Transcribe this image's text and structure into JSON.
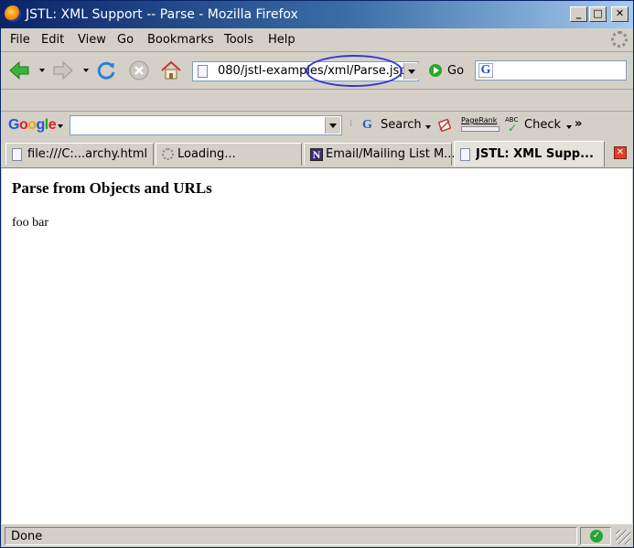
{
  "window": {
    "title": "JSTL: XML Support -- Parse - Mozilla Firefox",
    "minimize_label": "_",
    "maximize_label": "□",
    "close_label": "✕"
  },
  "menu": [
    "File",
    "Edit",
    "View",
    "Go",
    "Bookmarks",
    "Tools",
    "Help"
  ],
  "navigation": {
    "url": "080/jstl-examples/xml/Parse.jsp",
    "go_label": "Go",
    "search_engine_icon": "G",
    "search_value": ""
  },
  "google_toolbar": {
    "logo": [
      "G",
      "o",
      "o",
      "g",
      "l",
      "e"
    ],
    "search_value": "",
    "search_icon": "G",
    "search_label": "Search",
    "pagerank_label": "PageRank",
    "spell_label": "ABC",
    "spell_check_mark": "✓",
    "check_label": "Check",
    "more_label": "»"
  },
  "tabs": [
    {
      "label": "file:///C:...archy.html",
      "icon": "page-icon",
      "active": false
    },
    {
      "label": "Loading...",
      "icon": "loading-icon",
      "active": false
    },
    {
      "label": "Email/Mailing List M...",
      "icon": "n-site-icon",
      "active": false
    },
    {
      "label": "JSTL: XML Supp...",
      "icon": "page-icon",
      "active": true
    }
  ],
  "tab_close_label": "✕",
  "page": {
    "heading": "Parse from Objects and URLs",
    "text": "foo bar"
  },
  "status": {
    "text": "Done",
    "security_mark": "✓"
  },
  "colors": {
    "titlebar_start": "#0a246a",
    "titlebar_end": "#a6caf0",
    "chrome": "#d4d0c8",
    "annotation_ellipse": "#3333dd",
    "status_secure": "#22a633"
  }
}
